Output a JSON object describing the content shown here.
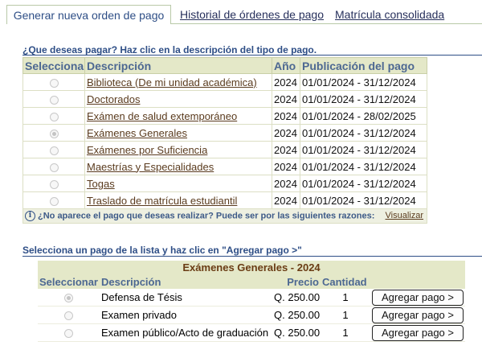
{
  "tabs": {
    "active": "Generar nueva orden de pago",
    "history": "Historial de órdenes de pago",
    "enrollment": "Matrícula consolidada"
  },
  "payment_types": {
    "heading": "¿Que deseas pagar? Haz clic en la descripción del tipo de pago.",
    "columns": {
      "select": "Seleccionar",
      "description": "Descripción",
      "year": "Año",
      "period": "Publicación del pago"
    },
    "rows": [
      {
        "description": "Biblioteca (De mi unidad académica)",
        "year": "2024",
        "period": "01/01/2024 - 31/12/2024",
        "selected": false
      },
      {
        "description": "Doctorados",
        "year": "2024",
        "period": "01/01/2024 - 31/12/2024",
        "selected": false
      },
      {
        "description": "Exámen de salud extemporáneo",
        "year": "2024",
        "period": "01/01/2024 - 28/02/2025",
        "selected": false
      },
      {
        "description": "Exámenes Generales",
        "year": "2024",
        "period": "01/01/2024 - 31/12/2024",
        "selected": true
      },
      {
        "description": "Exámenes por Suficiencia",
        "year": "2024",
        "period": "01/01/2024 - 31/12/2024",
        "selected": false
      },
      {
        "description": "Maestrías y Especialidades",
        "year": "2024",
        "period": "01/01/2024 - 31/12/2024",
        "selected": false
      },
      {
        "description": "Togas",
        "year": "2024",
        "period": "01/01/2024 - 31/12/2024",
        "selected": false
      },
      {
        "description": "Traslado de matrícula estudiantil",
        "year": "2024",
        "period": "01/01/2024 - 31/12/2024",
        "selected": false
      }
    ],
    "info_text": "¿No aparece el pago que deseas realizar? Puede ser por las siguientes razones:",
    "info_link": "Visualizar"
  },
  "cart": {
    "heading": "Selecciona un pago de la lista y haz clic en \"Agregar pago >\"",
    "title": "Exámenes Generales - 2024",
    "columns": {
      "select": "Seleccionar",
      "description": "Descripción",
      "price": "Precio",
      "quantity": "Cantidad"
    },
    "rows": [
      {
        "description": "Defensa de Tésis",
        "price": "Q. 250.00",
        "quantity": "1",
        "button": "Agregar pago >",
        "selected": true
      },
      {
        "description": "Examen privado",
        "price": "Q. 250.00",
        "quantity": "1",
        "button": "Agregar pago >",
        "selected": false
      },
      {
        "description": "Examen público/Acto de graduación",
        "price": "Q. 250.00",
        "quantity": "1",
        "button": "Agregar pago >",
        "selected": false
      }
    ]
  }
}
